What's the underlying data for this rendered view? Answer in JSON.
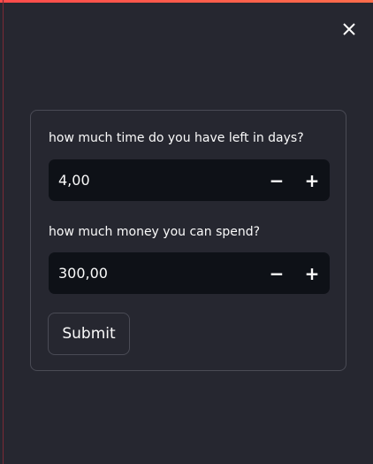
{
  "colors": {
    "accent_gradient": [
      "#ff4b4b",
      "#ff6c4b"
    ],
    "background": "#262730",
    "input_bg": "#0e1117"
  },
  "sidebar": {
    "close_icon": "close-icon"
  },
  "form": {
    "fields": [
      {
        "label": "how much time do you have left in days?",
        "value": "4,00",
        "minus": "−",
        "plus": "+"
      },
      {
        "label": "how much money you can spend?",
        "value": "300,00",
        "minus": "−",
        "plus": "+"
      }
    ],
    "submit_label": "Submit"
  }
}
